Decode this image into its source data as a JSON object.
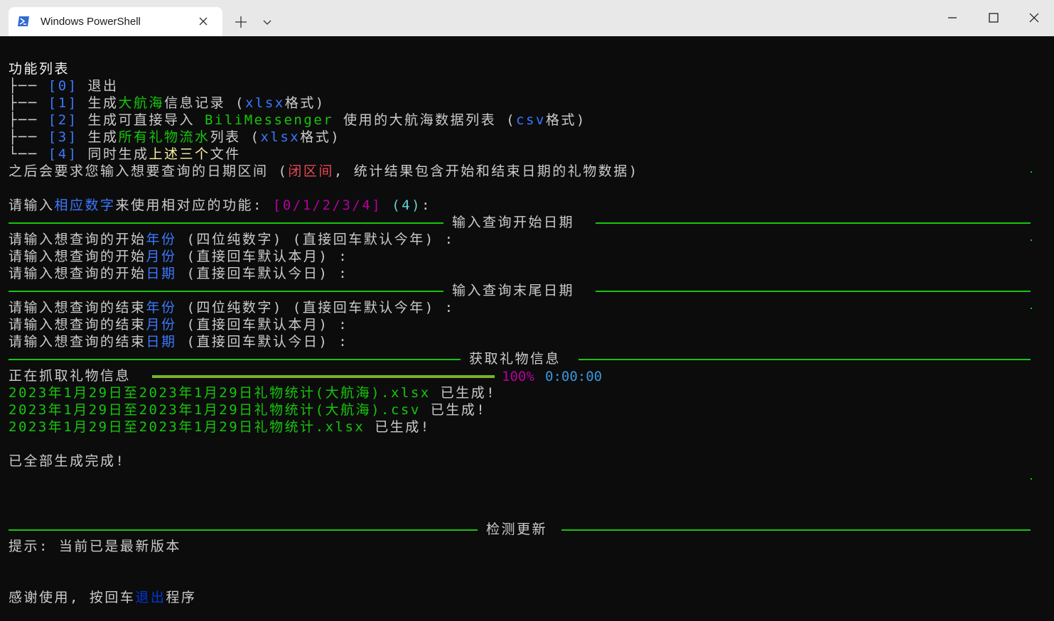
{
  "window": {
    "tab_title": "Windows PowerShell",
    "icons": {
      "app": "powershell-icon",
      "close_tab": "close-icon",
      "new_tab": "plus-icon",
      "dropdown": "chevron-down-icon",
      "minimize": "minimize-icon",
      "maximize": "maximize-icon",
      "close_window": "close-icon"
    },
    "colors": {
      "titlebar": "#e8e8e8",
      "tab": "#ffffff",
      "terminal_bg": "#0c0c0c"
    }
  },
  "terminal": {
    "menu": {
      "title": "功能列表",
      "items": [
        {
          "branch": "├── ",
          "key": "[0]",
          "pre": " 退出",
          "hl": "",
          "mid": "",
          "hl2": "",
          "post": ""
        },
        {
          "branch": "├── ",
          "key": "[1]",
          "pre": " 生成",
          "hl": "大航海",
          "mid": "信息记录 (",
          "hl2": "xlsx",
          "post": "格式)"
        },
        {
          "branch": "├── ",
          "key": "[2]",
          "pre": " 生成可直接导入 ",
          "hl": "BiliMessenger",
          "mid": " 使用的大航海数据列表 (",
          "hl2": "csv",
          "post": "格式)"
        },
        {
          "branch": "├── ",
          "key": "[3]",
          "pre": " 生成",
          "hl": "所有礼物流水",
          "mid": "列表 (",
          "hl2": "xlsx",
          "post": "格式)"
        },
        {
          "branch": "└── ",
          "key": "[4]",
          "pre": " 同时生成",
          "hl": "上述三个",
          "mid": "文件",
          "hl2": "",
          "post": ""
        }
      ],
      "note_pre": "之后会要求您输入想要查询的日期区间 (",
      "note_hl": "闭区间",
      "note_post": ", 统计结果包含开始和结束日期的礼物数据)"
    },
    "prompt": {
      "pre": "请输入",
      "hl": "相应数字",
      "post": "来使用相对应的功能: ",
      "choices": "[0/1/2/3/4]",
      "default": "(4)",
      "colon": ":"
    },
    "start_section": {
      "header": "输入查询开始日期",
      "lines": [
        {
          "pre": "请输入想查询的开始",
          "hl": "年份",
          "post": " (四位纯数字) (直接回车默认今年) :"
        },
        {
          "pre": "请输入想查询的开始",
          "hl": "月份",
          "post": " (直接回车默认本月) :"
        },
        {
          "pre": "请输入想查询的开始",
          "hl": "日期",
          "post": " (直接回车默认今日) :"
        }
      ]
    },
    "end_section": {
      "header": "输入查询末尾日期",
      "lines": [
        {
          "pre": "请输入想查询的结束",
          "hl": "年份",
          "post": " (四位纯数字) (直接回车默认今年) :"
        },
        {
          "pre": "请输入想查询的结束",
          "hl": "月份",
          "post": " (直接回车默认本月) :"
        },
        {
          "pre": "请输入想查询的结束",
          "hl": "日期",
          "post": " (直接回车默认今日) :"
        }
      ]
    },
    "fetch_section": {
      "header": "获取礼物信息",
      "progress_label": "正在抓取礼物信息",
      "progress_percent": "100%",
      "progress_value": 1.0,
      "elapsed": "0:00:00",
      "files": [
        {
          "name": "2023年1月29日至2023年1月29日礼物统计(大航海).xlsx",
          "status": " 已生成!"
        },
        {
          "name": "2023年1月29日至2023年1月29日礼物统计(大航海).csv",
          "status": " 已生成!"
        },
        {
          "name": "2023年1月29日至2023年1月29日礼物统计.xlsx",
          "status": " 已生成!"
        }
      ],
      "done": "已全部生成完成!"
    },
    "update_section": {
      "header": "检测更新",
      "tip": "提示: 当前已是最新版本"
    },
    "exit": {
      "pre": "感谢使用, 按回车",
      "hl": "退出",
      "post": "程序"
    }
  }
}
